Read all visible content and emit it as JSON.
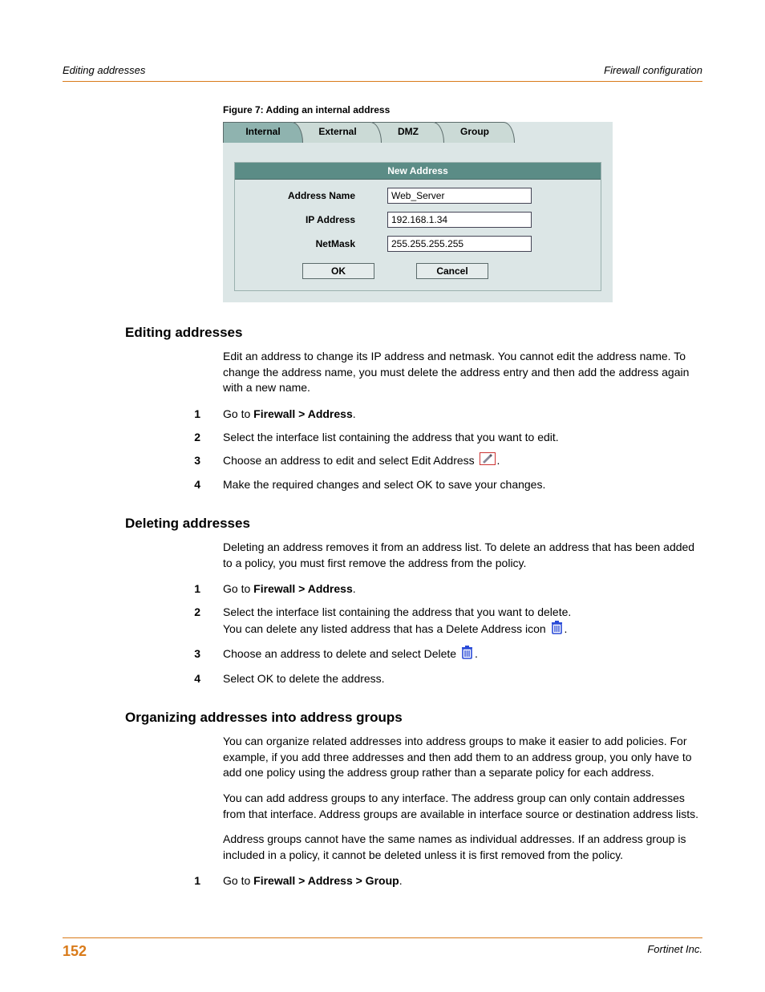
{
  "header": {
    "left": "Editing addresses",
    "right": "Firewall configuration"
  },
  "figure": {
    "caption": "Figure 7:   Adding an internal address",
    "tabs": {
      "internal": "Internal",
      "external": "External",
      "dmz": "DMZ",
      "group": "Group"
    },
    "panel_title": "New Address",
    "labels": {
      "name": "Address Name",
      "ip": "IP Address",
      "mask": "NetMask"
    },
    "values": {
      "name": "Web_Server",
      "ip": "192.168.1.34",
      "mask": "255.255.255.255"
    },
    "buttons": {
      "ok": "OK",
      "cancel": "Cancel"
    }
  },
  "sections": {
    "edit": {
      "title": "Editing addresses",
      "intro": "Edit an address to change its IP address and netmask. You cannot edit the address name. To change the address name, you must delete the address entry and then add the address again with a new name.",
      "steps": {
        "s1a": "Go to ",
        "s1b": "Firewall > Address",
        "s1c": ".",
        "s2": "Select the interface list containing the address that you want to edit.",
        "s3a": "Choose an address to edit and select Edit Address ",
        "s3b": ".",
        "s4": "Make the required changes and select OK to save your changes."
      }
    },
    "delete": {
      "title": "Deleting addresses",
      "intro": "Deleting an address removes it from an address list. To delete an address that has been added to a policy, you must first remove the address from the policy.",
      "steps": {
        "s1a": "Go to ",
        "s1b": "Firewall > Address",
        "s1c": ".",
        "s2a": "Select the interface list containing the address that you want to delete.",
        "s2b": "You can delete any listed address that has a Delete Address icon ",
        "s2c": ".",
        "s3a": "Choose an address to delete and select Delete ",
        "s3b": ".",
        "s4": "Select OK to delete the address."
      }
    },
    "groups": {
      "title": "Organizing addresses into address groups",
      "p1": "You can organize related addresses into address groups to make it easier to add policies. For example, if you add three addresses and then add them to an address group, you only have to add one policy using the address group rather than a separate policy for each address.",
      "p2": "You can add address groups to any interface. The address group can only contain addresses from that interface. Address groups are available in interface source or destination address lists.",
      "p3": "Address groups cannot have the same names as individual addresses. If an address group is included in a policy, it cannot be deleted unless it is first removed from the policy.",
      "steps": {
        "s1a": "Go to ",
        "s1b": "Firewall > Address > Group",
        "s1c": "."
      }
    }
  },
  "footer": {
    "page": "152",
    "right": "Fortinet Inc."
  }
}
